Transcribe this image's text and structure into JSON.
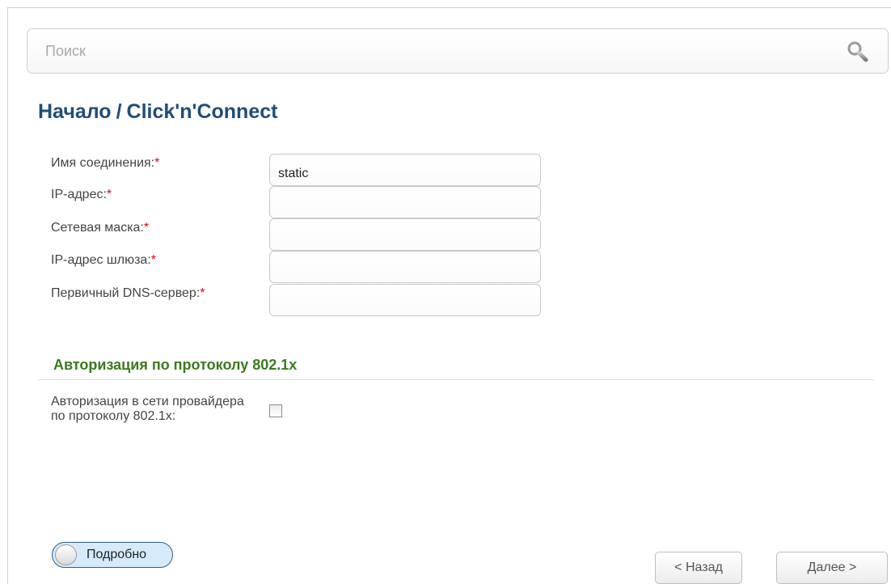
{
  "search": {
    "placeholder": "Поиск",
    "value": ""
  },
  "breadcrumb": {
    "root": "Начало",
    "separator": "/",
    "current": "Click'n'Connect"
  },
  "form": {
    "required_marker": "*",
    "fields": [
      {
        "label": "Имя соединения:",
        "value": "static"
      },
      {
        "label": "IP-адрес:",
        "value": ""
      },
      {
        "label": "Сетевая маска:",
        "value": ""
      },
      {
        "label": "IP-адрес шлюза:",
        "value": ""
      },
      {
        "label": "Первичный DNS-сервер:",
        "value": ""
      }
    ]
  },
  "auth_section": {
    "title": "Авторизация по протоколу 802.1x",
    "checkbox_label": "Авторизация в сети провайдера по протоколу 802.1x:",
    "checked": false
  },
  "toggle": {
    "label": "Подробно",
    "on": false
  },
  "nav": {
    "back_label": "< Назад",
    "next_label": "Далее >"
  },
  "colors": {
    "title": "#1f4e79",
    "section_title": "#3a7a1c",
    "required": "#e0001b",
    "toggle_bg": "#d6eafb"
  },
  "icons": {
    "search": "search-icon",
    "toggle_knob": "toggle-knob"
  }
}
